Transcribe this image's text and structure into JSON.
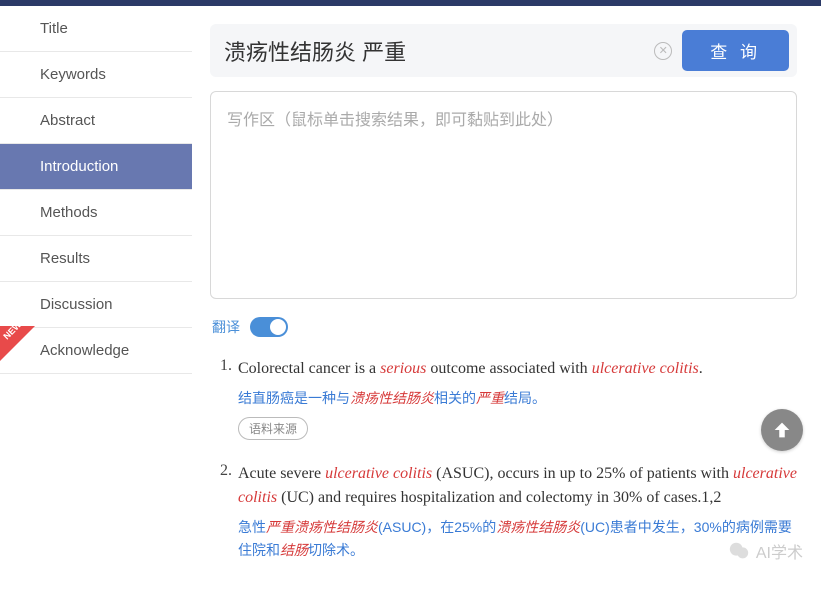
{
  "sidebar": {
    "items": [
      {
        "label": "Title"
      },
      {
        "label": "Keywords"
      },
      {
        "label": "Abstract"
      },
      {
        "label": "Introduction"
      },
      {
        "label": "Methods"
      },
      {
        "label": "Results"
      },
      {
        "label": "Discussion"
      },
      {
        "label": "Acknowledge"
      }
    ],
    "active_index": 3,
    "new_badge": "NEW"
  },
  "search": {
    "value": "溃疡性结肠炎 严重",
    "query_button": "查 询"
  },
  "writing_area": {
    "placeholder": "写作区（鼠标单击搜索结果，即可黏贴到此处）"
  },
  "translate": {
    "label": "翻译",
    "enabled": true
  },
  "results": [
    {
      "num": "1.",
      "en_parts": [
        {
          "t": "Colorectal cancer is a ",
          "h": false
        },
        {
          "t": "serious",
          "h": true
        },
        {
          "t": " outcome associated with ",
          "h": false
        },
        {
          "t": "ulcerative colitis",
          "h": true
        },
        {
          "t": ".",
          "h": false
        }
      ],
      "zh_parts": [
        {
          "t": "结直肠癌是一种与",
          "h": false
        },
        {
          "t": "溃疡性结肠炎",
          "h": true
        },
        {
          "t": "相关的",
          "h": false
        },
        {
          "t": "严重",
          "h": true
        },
        {
          "t": "结局。",
          "h": false
        }
      ],
      "source_label": "语料来源"
    },
    {
      "num": "2.",
      "en_parts": [
        {
          "t": "Acute severe ",
          "h": false
        },
        {
          "t": "ulcerative colitis",
          "h": true
        },
        {
          "t": " (ASUC), occurs in up to 25% of patients with ",
          "h": false
        },
        {
          "t": "ulcerative colitis",
          "h": true
        },
        {
          "t": " (UC) and requires hospitalization and colectomy in 30% of cases.1,2",
          "h": false
        }
      ],
      "zh_parts": [
        {
          "t": "急性",
          "h": false
        },
        {
          "t": "严重溃疡性结肠炎",
          "h": true
        },
        {
          "t": "(ASUC)，在25%的",
          "h": false
        },
        {
          "t": "溃疡性结肠炎",
          "h": true
        },
        {
          "t": "(UC)患者中发生，30%的病例需要住院和",
          "h": false
        },
        {
          "t": "结肠",
          "h": true
        },
        {
          "t": "切除术。",
          "h": false
        }
      ]
    }
  ],
  "watermark": "AI学术"
}
